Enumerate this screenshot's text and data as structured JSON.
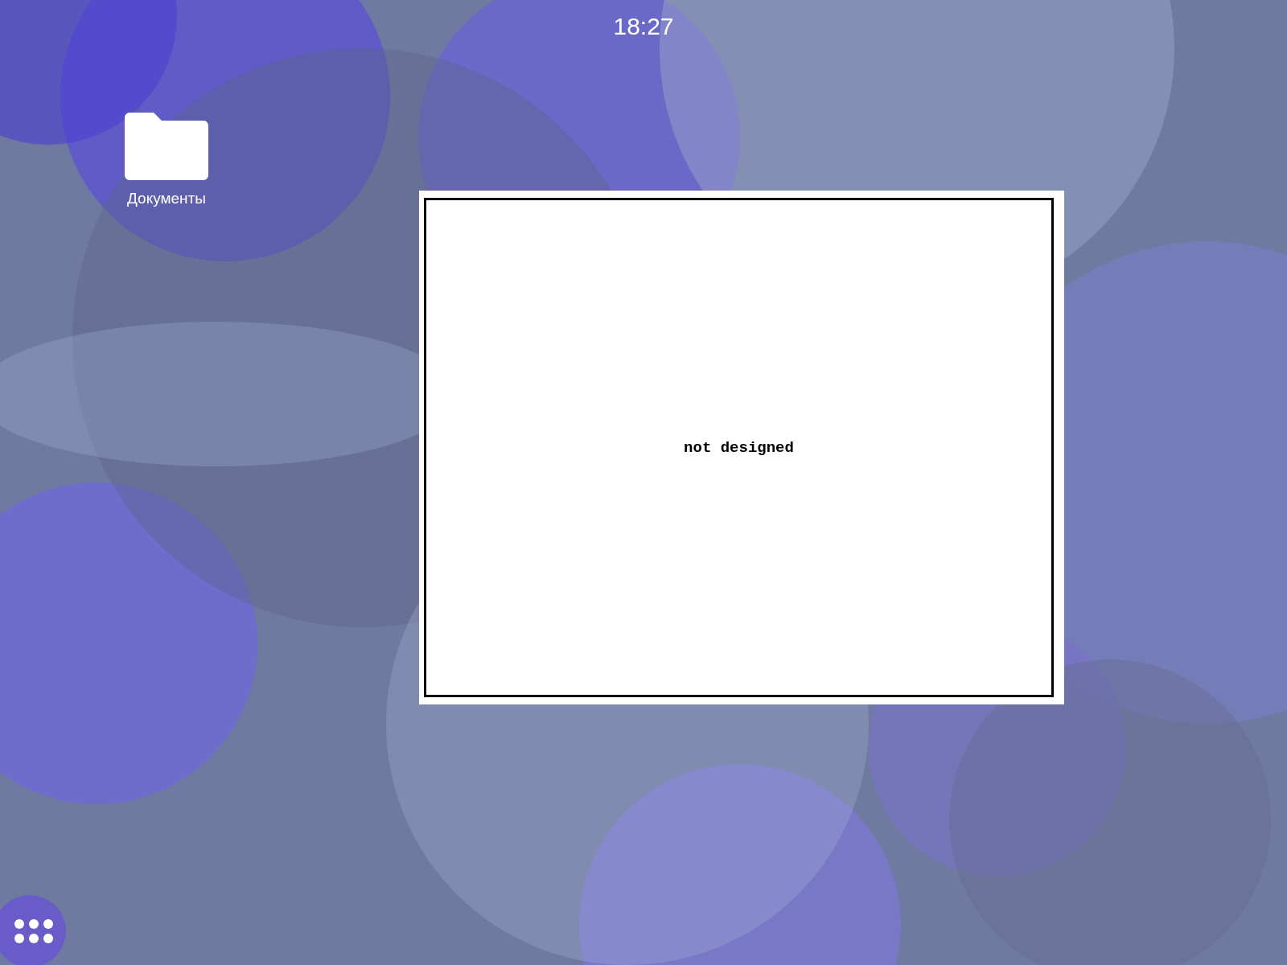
{
  "status_bar": {
    "time": "18:27"
  },
  "desktop_icons": [
    {
      "label": "Документы",
      "kind": "folder"
    }
  ],
  "dialog": {
    "message": "not designed"
  }
}
